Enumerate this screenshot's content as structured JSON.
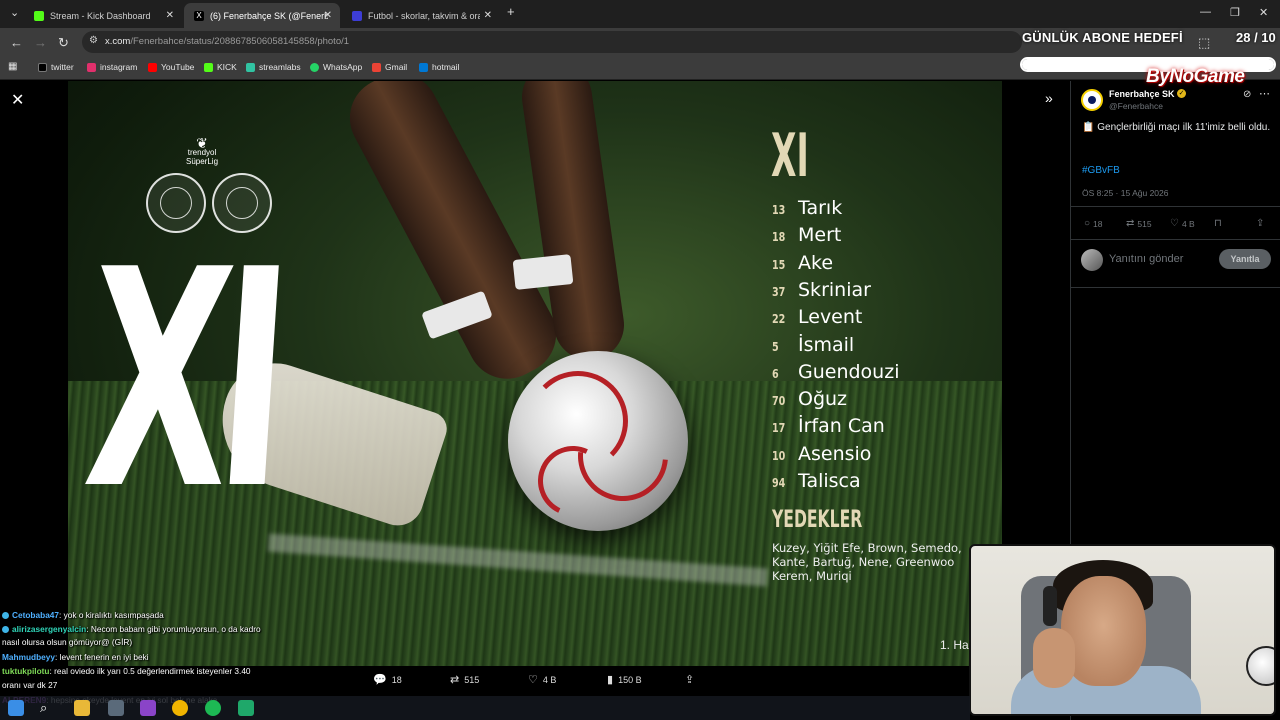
{
  "browser": {
    "tabs": [
      {
        "label": "Stream - Kick Dashboard",
        "color": "#53fc18"
      },
      {
        "label": "(6) Fenerbahçe SK (@Fenerbahç",
        "color": "#000000"
      },
      {
        "label": "Futbol - skorlar, takvim & oran",
        "color": "#3d3dd6"
      }
    ],
    "new_tab": "+",
    "url_host": "x.com",
    "url_path": "/Fenerbahce/status/2088678506058145858/photo/1",
    "bookmarks": [
      {
        "label": "twitter",
        "color": "#000000"
      },
      {
        "label": "instagram",
        "color": "#e1306c"
      },
      {
        "label": "YouTube",
        "color": "#ff0000"
      },
      {
        "label": "KICK",
        "color": "#53fc18"
      },
      {
        "label": "streamlabs",
        "color": "#31c3a2"
      },
      {
        "label": "WhatsApp",
        "color": "#25d366"
      },
      {
        "label": "Gmail",
        "color": "#ea4335"
      },
      {
        "label": "hotmail",
        "color": "#0078d4"
      }
    ]
  },
  "overlay": {
    "goal_title": "GÜNLÜK ABONE HEDEFİ",
    "goal_count": "28 / 10",
    "goal_progress": 1.0,
    "brand": "ByNoGame"
  },
  "photo": {
    "league": [
      "trendyol",
      "SüperLig"
    ],
    "big_text": "XI",
    "heading": "XI",
    "players": [
      {
        "num": "13",
        "name": "Tarık"
      },
      {
        "num": "18",
        "name": "Mert"
      },
      {
        "num": "15",
        "name": "Ake"
      },
      {
        "num": "37",
        "name": "Skriniar"
      },
      {
        "num": "22",
        "name": "Levent"
      },
      {
        "num": "5",
        "name": "İsmail"
      },
      {
        "num": "6",
        "name": "Guendouzi"
      },
      {
        "num": "70",
        "name": "Oğuz"
      },
      {
        "num": "17",
        "name": "İrfan Can"
      },
      {
        "num": "10",
        "name": "Asensio"
      },
      {
        "num": "94",
        "name": "Talisca"
      }
    ],
    "subs_heading": "YEDEKLER",
    "subs_lines": [
      "Kuzey, Yiğit Efe, Brown, Semedo,",
      "Kante, Bartuğ, Nene, Greenwoo",
      "Kerem, Muriqi"
    ],
    "week": "1. Ha"
  },
  "photo_actions": {
    "replies": "18",
    "reposts": "515",
    "likes": "4 B",
    "views": "150 B"
  },
  "chat": [
    {
      "user": "Cetobaba47",
      "user_color": "#4fb0ff",
      "text": ": yok o kiralıktı kasımpaşada",
      "badge": true
    },
    {
      "user": "alirizasergenyalcin",
      "user_color": "#2fd4b8",
      "text": ": Necom babam gibi yorumluyorsun, o da kadro",
      "badge": true
    },
    {
      "user": "",
      "user_color": "#ffffff",
      "text": "nasıl olursa olsun gömüyor@ (GİR)",
      "badge": false
    },
    {
      "user": "Mahmudbeyy",
      "user_color": "#4fb0ff",
      "text": ": levent fenerin en iyi beki",
      "badge": false
    },
    {
      "user": "tuktukpilotu",
      "user_color": "#7ed957",
      "text": ": real oviedo ilk yarı 0.5 değerlendirmek isteyenler 3.40",
      "badge": false
    },
    {
      "user": "",
      "user_color": "#ffffff",
      "text": "oranı var dk 27",
      "badge": false
    },
    {
      "user": "ALPEREN9",
      "user_color": "#c46bff",
      "text": ": hepsine okeyde levent en iyi sol bek ne alaka",
      "badge": false
    }
  ],
  "tweet": {
    "name": "Fenerbahçe SK",
    "handle": "@Fenerbahce",
    "text": "📋 Gençlerbirliği maçı ilk 11'imiz belli oldu.",
    "hashtag": "#GBvFB",
    "time": "ÖS 8:25 · 15 Ağu 2026",
    "replies": "18",
    "reposts": "515",
    "likes": "4 B",
    "reply_placeholder": "Yanıtını gönder",
    "reply_button": "Yanıtla"
  }
}
